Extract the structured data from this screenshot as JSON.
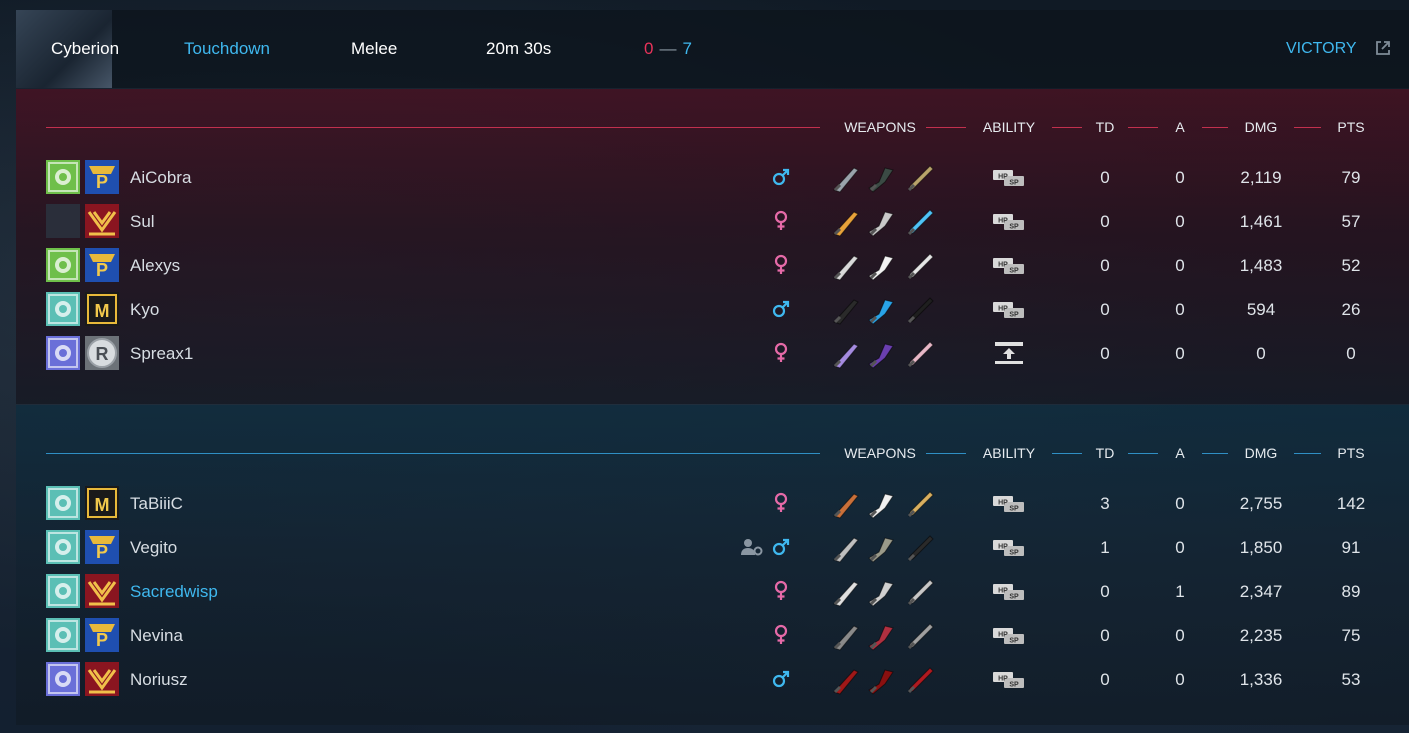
{
  "match": {
    "map": "Cyberion",
    "mode": "Touchdown",
    "type": "Melee",
    "duration": "20m 30s",
    "score_red": "0",
    "score_sep": "—",
    "score_blue": "7",
    "result": "VICTORY"
  },
  "columns": {
    "weapons": "WEAPONS",
    "ability": "ABILITY",
    "td": "TD",
    "a": "A",
    "dmg": "DMG",
    "pts": "PTS"
  },
  "colors": {
    "accent_blue": "#3fb8ef",
    "accent_red": "#e8335a",
    "male": "#3fb8ef",
    "female": "#e66aa8"
  },
  "teams": [
    {
      "side": "red",
      "players": [
        {
          "name": "AiCobra",
          "gender": "male",
          "ability_icon": "hp-sp-icon",
          "td": "0",
          "a": "0",
          "dmg": "2,119",
          "pts": "79"
        },
        {
          "name": "Sul",
          "gender": "female",
          "ability_icon": "hp-sp-icon",
          "td": "0",
          "a": "0",
          "dmg": "1,461",
          "pts": "57"
        },
        {
          "name": "Alexys",
          "gender": "female",
          "ability_icon": "hp-sp-icon",
          "td": "0",
          "a": "0",
          "dmg": "1,483",
          "pts": "52"
        },
        {
          "name": "Kyo",
          "gender": "male",
          "ability_icon": "hp-sp-icon",
          "td": "0",
          "a": "0",
          "dmg": "594",
          "pts": "26"
        },
        {
          "name": "Spreax1",
          "gender": "female",
          "ability_icon": "upload-ability-icon",
          "td": "0",
          "a": "0",
          "dmg": "0",
          "pts": "0"
        }
      ]
    },
    {
      "side": "blue",
      "players": [
        {
          "name": "TaBiiiC",
          "gender": "female",
          "ability_icon": "hp-sp-icon",
          "td": "3",
          "a": "0",
          "dmg": "2,755",
          "pts": "142"
        },
        {
          "name": "Vegito",
          "gender": "male",
          "party": true,
          "ability_icon": "hp-sp-icon",
          "td": "1",
          "a": "0",
          "dmg": "1,850",
          "pts": "91"
        },
        {
          "name": "Sacredwisp",
          "gender": "female",
          "highlight": true,
          "ability_icon": "hp-sp-icon",
          "td": "0",
          "a": "1",
          "dmg": "2,347",
          "pts": "89"
        },
        {
          "name": "Nevina",
          "gender": "female",
          "ability_icon": "hp-sp-icon",
          "td": "0",
          "a": "0",
          "dmg": "2,235",
          "pts": "75"
        },
        {
          "name": "Noriusz",
          "gender": "male",
          "ability_icon": "hp-sp-icon",
          "td": "0",
          "a": "0",
          "dmg": "1,336",
          "pts": "53"
        }
      ]
    }
  ]
}
